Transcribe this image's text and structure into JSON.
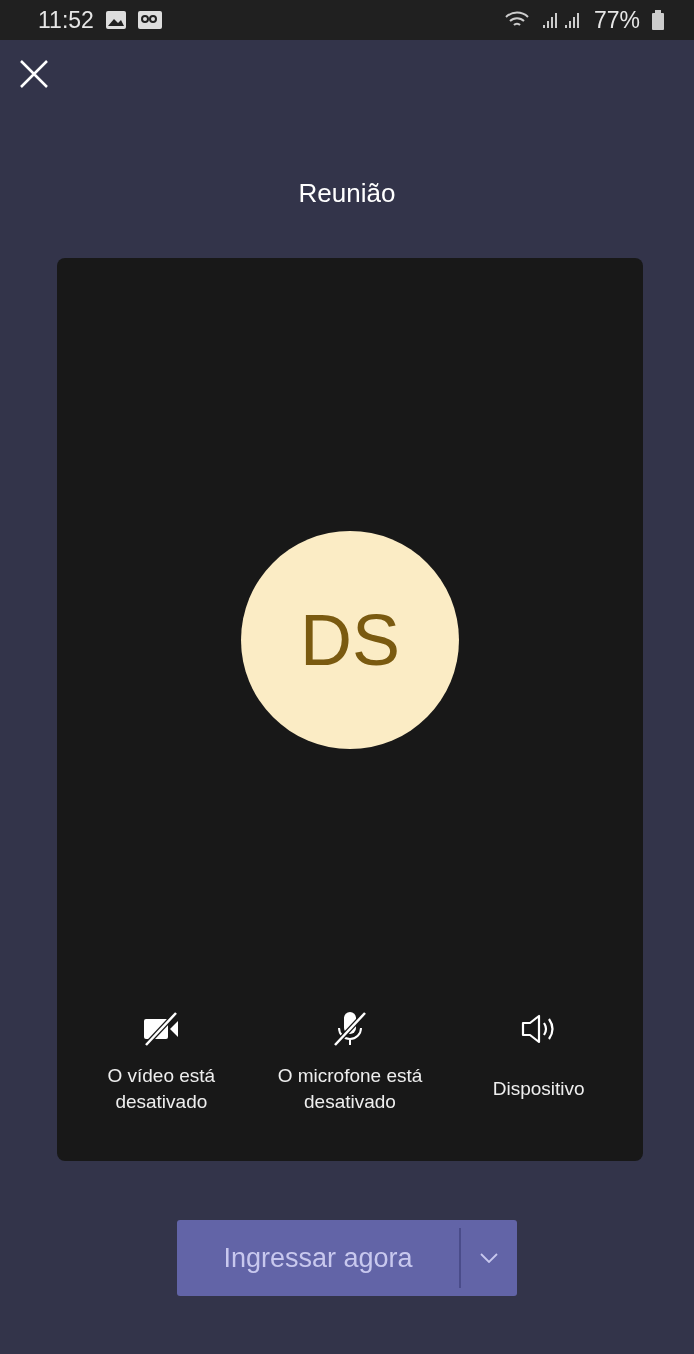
{
  "status_bar": {
    "time": "11:52",
    "battery": "77%"
  },
  "title": "Reunião",
  "avatar": {
    "initials": "DS"
  },
  "controls": [
    {
      "kind": "camera",
      "off": true,
      "label": "O vídeo está desativado"
    },
    {
      "kind": "microphone",
      "off": true,
      "label": "O microfone está desativado"
    },
    {
      "kind": "speaker",
      "off": false,
      "label": "Dispositivo"
    }
  ],
  "join_button": {
    "label": "Ingressar agora"
  }
}
